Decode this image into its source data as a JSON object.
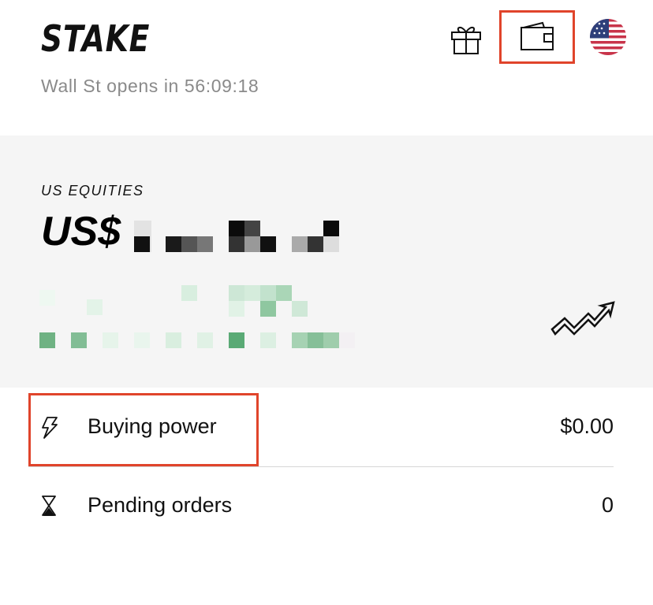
{
  "header": {
    "logo_text": "STAKE",
    "market_status": "Wall St opens in 56:09:18",
    "icons": [
      "gift-icon",
      "wallet-icon",
      "us-flag-icon"
    ]
  },
  "portfolio": {
    "section_label": "US EQUITIES",
    "currency_prefix": "US$",
    "trend_icon": "trend-up-icon"
  },
  "rows": [
    {
      "label": "Buying power",
      "value": "$0.00",
      "icon": "lightning-icon"
    },
    {
      "label": "Pending orders",
      "value": "0",
      "icon": "hourglass-icon"
    }
  ],
  "colors": {
    "highlight": "#e0442b",
    "card_background": "#f5f5f5",
    "muted_text": "#8a8a8a",
    "gain_green": "#5aaa75"
  }
}
